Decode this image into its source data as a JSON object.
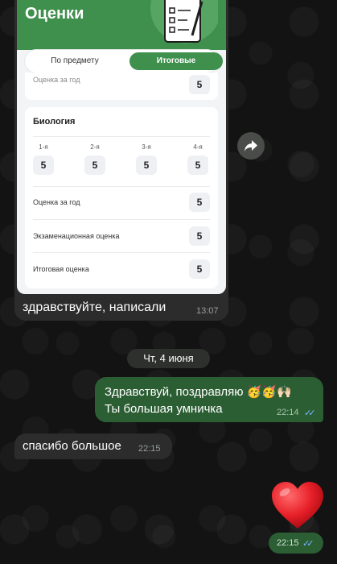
{
  "screenshot": {
    "app_title": "Оценки",
    "tabs": {
      "by_subject": "По предмету",
      "final": "Итоговые"
    },
    "peek_label": "Оценка за год",
    "peek_value": "5",
    "subject": "Биология",
    "quarters": [
      {
        "label": "1-я",
        "value": "5"
      },
      {
        "label": "2-я",
        "value": "5"
      },
      {
        "label": "3-я",
        "value": "5"
      },
      {
        "label": "4-я",
        "value": "5"
      }
    ],
    "rows": [
      {
        "label": "Оценка за год",
        "value": "5"
      },
      {
        "label": "Экзаменационная оценка",
        "value": "5"
      },
      {
        "label": "Итоговая оценка",
        "value": "5"
      }
    ]
  },
  "messages": {
    "img_caption": "здравствуйте, написали",
    "img_time": "13:07",
    "date_separator": "Чт, 4 июня",
    "outgoing_line1": "Здравствуй, поздравляю 🥳🥳🙌🏻",
    "outgoing_line2": "Ты большая умничка",
    "outgoing_time": "22:14",
    "incoming_text": "спасибо большое",
    "incoming_time": "22:15",
    "heart_time": "22:15"
  },
  "icons": {
    "forward": "forward-arrow-icon",
    "read_ticks": "double-check-icon",
    "heart": "red-heart-emoji"
  },
  "colors": {
    "app_green": "#3f8f4d",
    "outgoing_bubble": "#2c5e34",
    "incoming_bubble": "#2b2c2b",
    "read_tick": "#7ab6ff"
  }
}
